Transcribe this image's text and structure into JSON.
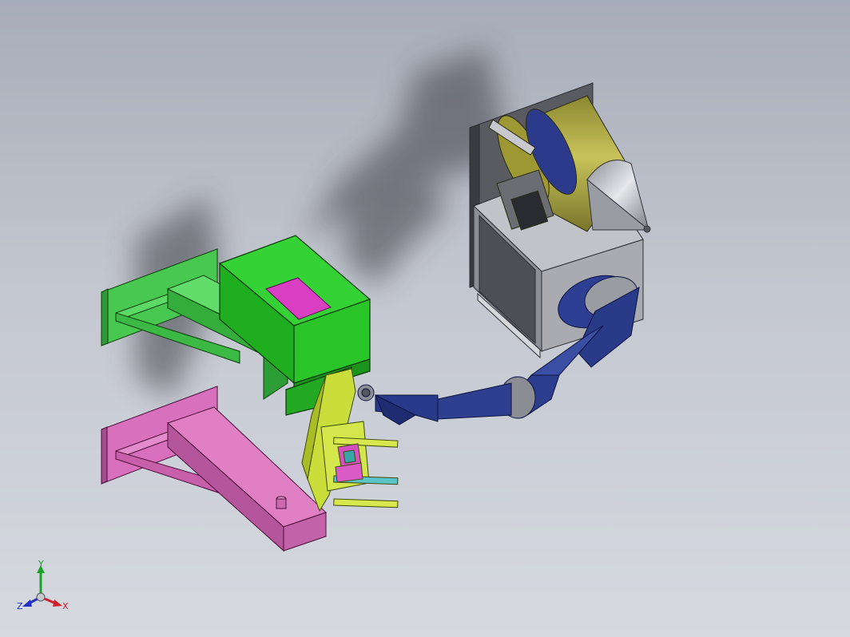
{
  "viewport": {
    "background_top": "#a7acb9",
    "background_bottom": "#d6d9e0"
  },
  "model": {
    "parts": [
      {
        "name": "green-wall-bracket",
        "color": "#3fcf45"
      },
      {
        "name": "green-housing-box",
        "color": "#22c722"
      },
      {
        "name": "magenta-label-plate",
        "color": "#d83fc3"
      },
      {
        "name": "pink-wall-bracket",
        "color": "#d46eb8"
      },
      {
        "name": "yellow-gripper-fixture",
        "color": "#c9de3a"
      },
      {
        "name": "robot-arm",
        "color": "#2f3f8f"
      },
      {
        "name": "grey-base-cabinet",
        "color": "#a4a6ad"
      },
      {
        "name": "olive-cylinder-tank",
        "color": "#a8a33a"
      },
      {
        "name": "silver-nose-cone",
        "color": "#c7c9cf"
      }
    ]
  },
  "triad": {
    "x_label": "X",
    "y_label": "Y",
    "z_label": "Z",
    "x_color": "#d0202a",
    "y_color": "#1aa32a",
    "z_color": "#2030c8"
  }
}
